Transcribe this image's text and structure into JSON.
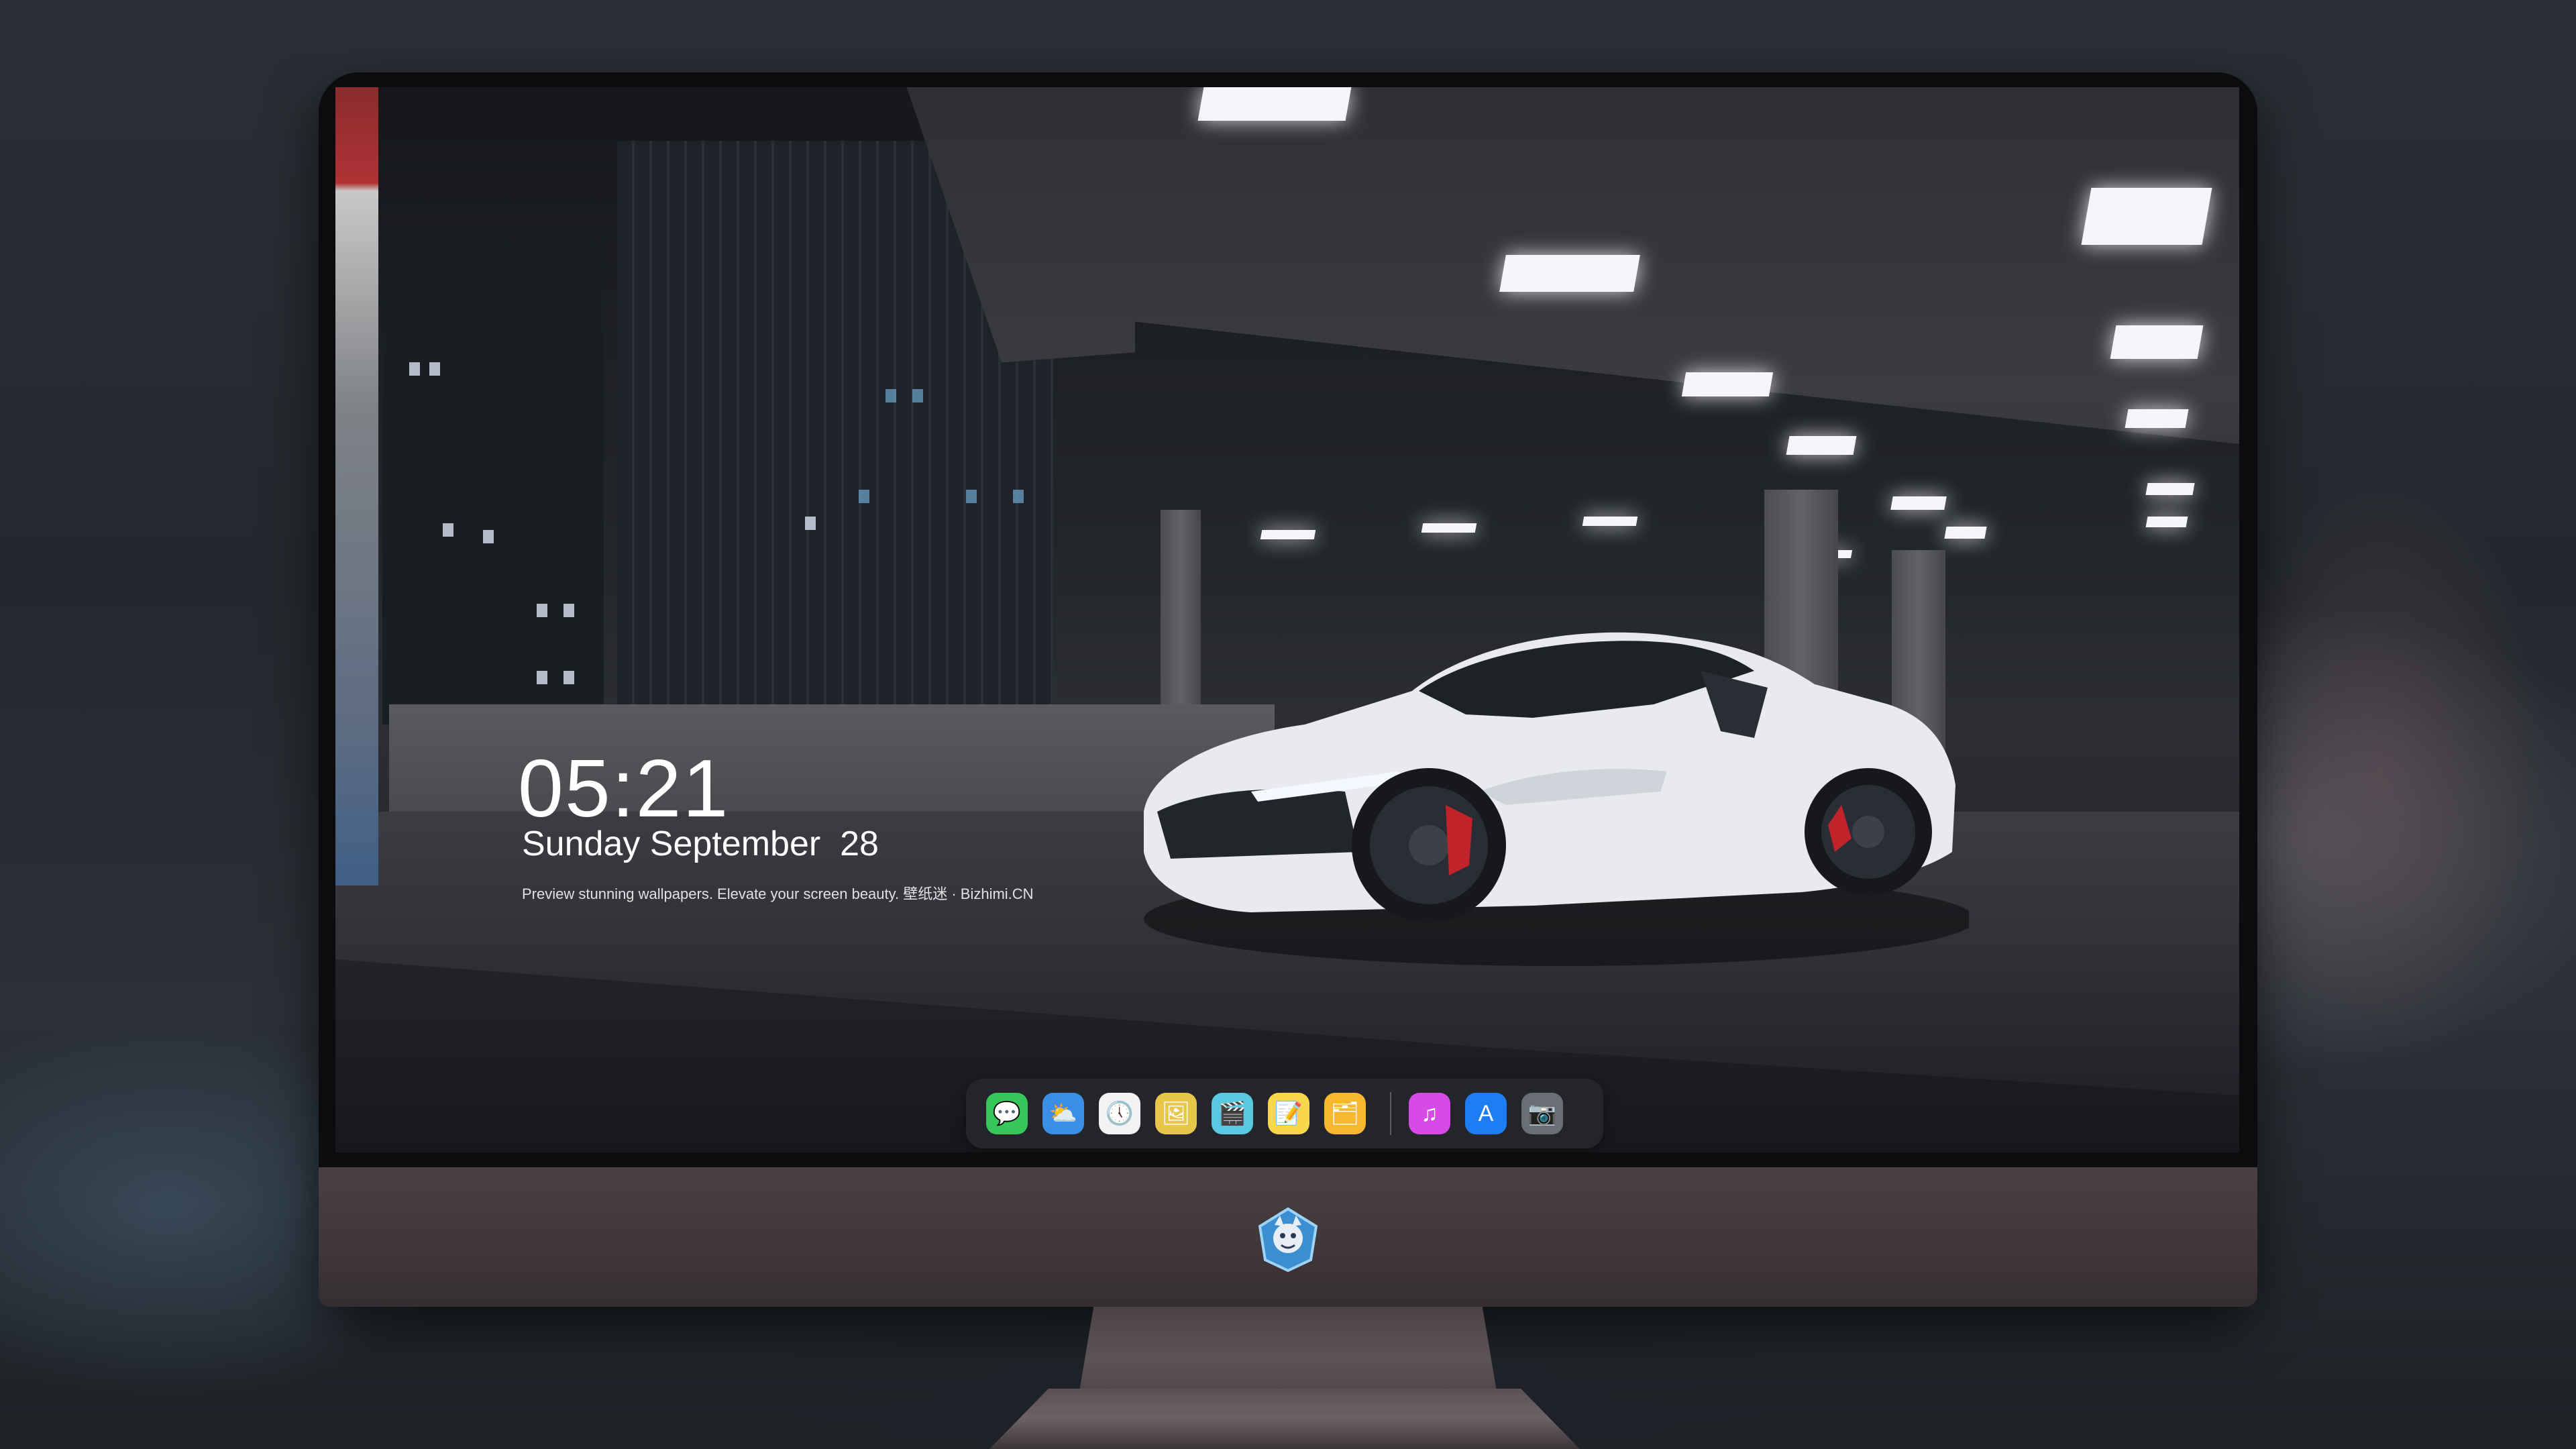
{
  "lock_screen": {
    "time": "05:21",
    "date": "Sunday September  28",
    "tagline": "Preview stunning wallpapers. Elevate your screen beauty. 壁纸迷 · Bizhimi.CN"
  },
  "dock": {
    "apps": [
      {
        "name": "messages-icon",
        "glyph": "💬",
        "color": "#35c759"
      },
      {
        "name": "weather-icon",
        "glyph": "⛅",
        "color": "#3a8ee6"
      },
      {
        "name": "clock-icon",
        "glyph": "🕔",
        "color": "#f2f2f2"
      },
      {
        "name": "preview-icon",
        "glyph": "🖼",
        "color": "#e8c64a"
      },
      {
        "name": "clips-icon",
        "glyph": "🎬",
        "color": "#5ac8e0"
      },
      {
        "name": "notes-icon",
        "glyph": "📝",
        "color": "#f8d74a"
      },
      {
        "name": "photos-icon",
        "glyph": "🗂",
        "color": "#f7b731"
      },
      {
        "name": "music-icon",
        "glyph": "♫",
        "color": "#d64be6"
      },
      {
        "name": "app-store-icon",
        "glyph": "A",
        "color": "#1e7df5"
      },
      {
        "name": "camera-icon",
        "glyph": "📷",
        "color": "#6b6e75"
      }
    ]
  },
  "colors": {
    "chin": "#3f3639",
    "accent_red": "#b03234"
  }
}
